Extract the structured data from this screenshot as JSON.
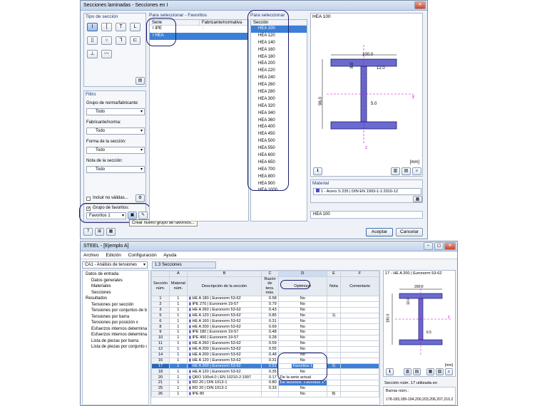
{
  "dialog": {
    "title": "Secciones laminadas - Secciones en I",
    "tipo_seccion_label": "Tipo de sección",
    "filtro_label": "Filtro",
    "grupo_norma_label": "Grupo de norma/fabricante:",
    "grupo_norma_value": "Todo",
    "fabricante_label": "Fabricante/norma:",
    "fabricante_value": "Todo",
    "forma_label": "Forma de la sección:",
    "forma_value": "Todo",
    "nota_label": "Nota de la sección:",
    "nota_value": "Todo",
    "incluir_label": "Incluir no válidas...",
    "grupo_fav_label": "Grupo de favoritos:",
    "grupo_fav_value": "Favoritos 1",
    "tooltip": "Crear nuevo grupo de favoritos...",
    "para_sel_fav": "Para seleccionar - Favoritos",
    "col_serie": "Serie",
    "col_fab": "Fabricante/normativa",
    "series": [
      {
        "name": "IPE",
        "fab": "-"
      },
      {
        "name": "HEA",
        "fab": ""
      }
    ],
    "para_sel": "Para seleccionar",
    "col_seccion": "Sección",
    "sections": [
      "HEA 100",
      "HEA 120",
      "HEA 140",
      "HEA 160",
      "HEA 180",
      "HEA 200",
      "HEA 220",
      "HEA 240",
      "HEA 260",
      "HEA 280",
      "HEA 300",
      "HEA 320",
      "HEA 340",
      "HEA 360",
      "HEA 400",
      "HEA 450",
      "HEA 500",
      "HEA 550",
      "HEA 600",
      "HEA 650",
      "HEA 700",
      "HEA 800",
      "HEA 900",
      "HEA 1000"
    ],
    "preview_title": "HEA 100",
    "dims": {
      "b": "100.0",
      "h": "96.0",
      "tf": "8.0",
      "r": "12.0",
      "tw": "5.0"
    },
    "unit": "[mm]",
    "material_label": "Material",
    "material_value": "1 - Acero S 235 | DIN EN 1993-1-1:2010-12",
    "name_value": "HEA 100",
    "ok": "Aceptar",
    "cancel": "Cancelar"
  },
  "steel": {
    "title": "STEEL - [Ejemplo A]",
    "menu": [
      "Archivo",
      "Edición",
      "Configuración",
      "Ayuda"
    ],
    "case_value": "CA1 - Análisis de tensiones",
    "tab": "1.3 Secciones",
    "tree": [
      "Datos de entrada",
      "Datos generales",
      "Materiales",
      "Secciones",
      "Resultados",
      "Tensiones por sección",
      "Tensiones por conjuntos de ba",
      "Tensiones por barra",
      "Tensiones por posición x",
      "Esfuerzos internos determinante",
      "Esfuerzos internos determinante",
      "Lista de piezas por barra",
      "Lista de piezas por conjunto de"
    ],
    "cols": [
      "A",
      "B",
      "C",
      "D",
      "E",
      "F"
    ],
    "head": [
      "Sección núm.",
      "Material núm.",
      "Descripción de la sección",
      "Razón de tens. máx.",
      "Optimizar",
      "Nota",
      "Comentario"
    ],
    "rows": [
      [
        "1",
        "1",
        "HE A 180 | Euronorm 53-62",
        "0.58",
        "No",
        ""
      ],
      [
        "2",
        "1",
        "IPE 270 | Euronorm 19-57",
        "0.79",
        "No",
        ""
      ],
      [
        "3",
        "1",
        "HE A 260 | Euronorm 53-62",
        "0.43",
        "No",
        ""
      ],
      [
        "5",
        "1",
        "HE A 120 | Euronorm 53-62",
        "0.85",
        "No",
        "1)"
      ],
      [
        "6",
        "1",
        "HE A 160 | Euronorm 53-62",
        "0.31",
        "No",
        ""
      ],
      [
        "8",
        "1",
        "HE A 200 | Euronorm 53-62",
        "0.69",
        "No",
        ""
      ],
      [
        "9",
        "1",
        "IPE 180 | Euronorm 19-57",
        "0.48",
        "No",
        ""
      ],
      [
        "10",
        "1",
        "IPE 400 | Euronorm 19-57",
        "0.28",
        "No",
        ""
      ],
      [
        "11",
        "1",
        "HE A 260 | Euronorm 53-62",
        "0.59",
        "No",
        ""
      ],
      [
        "12",
        "1",
        "HE A 200 | Euronorm 53-62",
        "0.55",
        "No",
        ""
      ],
      [
        "14",
        "1",
        "HE A 200 | Euronorm 53-62",
        "0.48",
        "No",
        ""
      ],
      [
        "16",
        "1",
        "HE A 120 | Euronorm 53-62",
        "0.31",
        "No",
        ""
      ],
      [
        "17",
        "1",
        "HE A 200 | Euronorm 53-62",
        "0.91",
        "Favoritos 1",
        "2)"
      ],
      [
        "18",
        "1",
        "HE A 120 | Euronorm 53-62",
        "0.35",
        "No",
        ""
      ],
      [
        "20",
        "1",
        "QRO 100x4.0 | EN 10210-2:1997",
        "0.17",
        "De la serie actual",
        ""
      ],
      [
        "21",
        "1",
        "RD 20 | DIN 1013-1",
        "0.80",
        "De favoritos \"Favoritos 1\"",
        ""
      ],
      [
        "25",
        "1",
        "RD 20 | DIN 1013-1",
        "0.33",
        "No",
        ""
      ],
      [
        "26",
        "1",
        "IPE 80",
        "",
        "No",
        "8)"
      ]
    ],
    "preview_title": "17 - HE A 200 | Euronorm 53-62",
    "dims": {
      "b": "200.0",
      "h": "190.0",
      "tf": "10.0",
      "tw": "6.5"
    },
    "unit": "[mm]",
    "used_label": "Sección núm. 17 utilizada en",
    "barras_label": "Barras núm.:",
    "barras_value": "178-183,189-194,200,203,206,207,210,2"
  }
}
